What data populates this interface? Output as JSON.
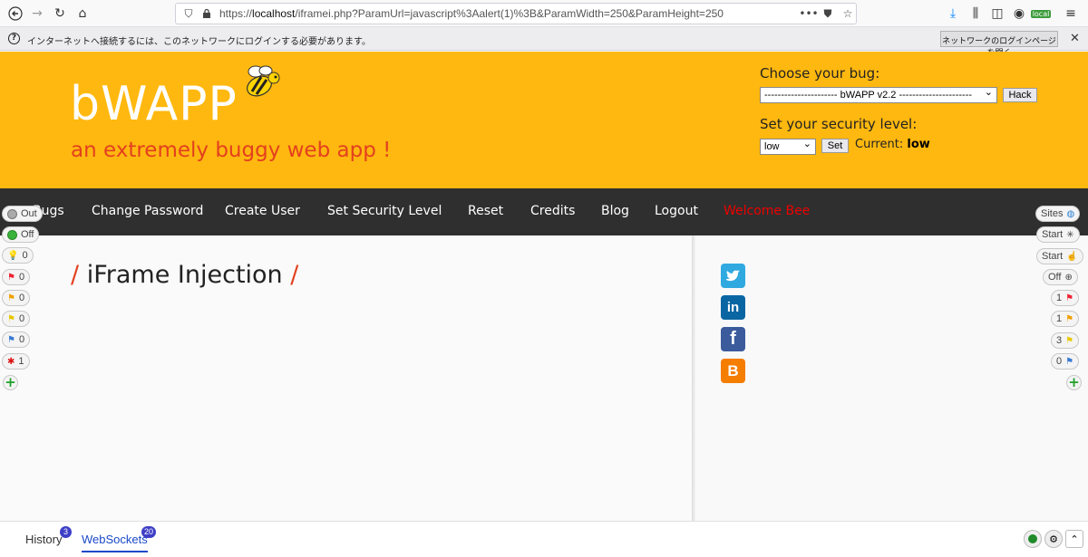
{
  "browser": {
    "url_prefix": "https://",
    "url_host": "localhost",
    "url_rest": "/iframei.php?ParamUrl=javascript%3Aalert(1)%3B&ParamWidth=250&ParamHeight=250",
    "profile_badge": "local"
  },
  "notification": {
    "text": "インターネットへ接続するには、このネットワークにログインする必要があります。",
    "button_label": "ネットワークのログインページを開く"
  },
  "header": {
    "logo": "bWAPP",
    "tagline": "an extremely buggy web app !",
    "choose_label": "Choose your bug:",
    "bug_selected": "---------------------- bWAPP v2.2 ----------------------",
    "hack_label": "Hack",
    "security_label": "Set your security level:",
    "security_selected": "low",
    "set_label": "Set",
    "current_label": "Current:",
    "current_value": "low"
  },
  "nav": {
    "items": [
      "Bugs",
      "Change Password",
      "Create User",
      "Set Security Level",
      "Reset",
      "Credits",
      "Blog",
      "Logout"
    ],
    "welcome": "Welcome Bee"
  },
  "page": {
    "title": "iFrame Injection"
  },
  "left_pills": [
    {
      "label": "Out",
      "color": "#aaaaaa"
    },
    {
      "label": "Off",
      "color": "#3bb33b"
    },
    {
      "label": "0",
      "icon": "bulb-icon"
    },
    {
      "label": "0",
      "icon": "red-flag-icon"
    },
    {
      "label": "0",
      "icon": "orange-flag-icon"
    },
    {
      "label": "0",
      "icon": "yellow-flag-icon"
    },
    {
      "label": "0",
      "icon": "blue-flag-icon"
    },
    {
      "label": "1",
      "icon": "bug-icon"
    }
  ],
  "right_pills": [
    {
      "label": "Sites",
      "icon": "globe-icon"
    },
    {
      "label": "Start",
      "icon": "spider-icon"
    },
    {
      "label": "Start",
      "icon": "hand-icon"
    },
    {
      "label": "Off",
      "icon": "crosshair-icon"
    },
    {
      "label": "1",
      "icon": "red-flag-icon"
    },
    {
      "label": "1",
      "icon": "orange-flag-icon"
    },
    {
      "label": "3",
      "icon": "yellow-flag-icon"
    },
    {
      "label": "0",
      "icon": "blue-flag-icon"
    }
  ],
  "bottom": {
    "history_label": "History",
    "history_count": "3",
    "websockets_label": "WebSockets",
    "websockets_count": "20"
  }
}
